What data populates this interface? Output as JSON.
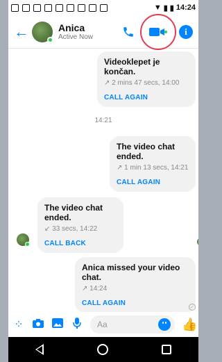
{
  "statusbar": {
    "time": "14:24"
  },
  "header": {
    "name": "Anica",
    "status": "Active Now",
    "info_icon": "i"
  },
  "messages": [
    {
      "title": "Videoklepet je končan.",
      "meta": "↗ 2 mins 47 secs, 14:00",
      "action": "CALL AGAIN"
    },
    {
      "title": "The video chat ended.",
      "meta": "↗ 1 min 13 secs, 14:21",
      "action": "CALL AGAIN"
    },
    {
      "title": "The video chat ended.",
      "meta": "↙ 33 secs, 14:22",
      "action": "CALL BACK"
    },
    {
      "title": "Anica missed your video chat.",
      "meta": "↗ 14:24",
      "action": "CALL AGAIN"
    }
  ],
  "time_separator": "14:21",
  "composer": {
    "placeholder": "Aa"
  },
  "colors": {
    "accent": "#0084ff",
    "online": "#31cc46",
    "highlight": "#e53b52"
  }
}
